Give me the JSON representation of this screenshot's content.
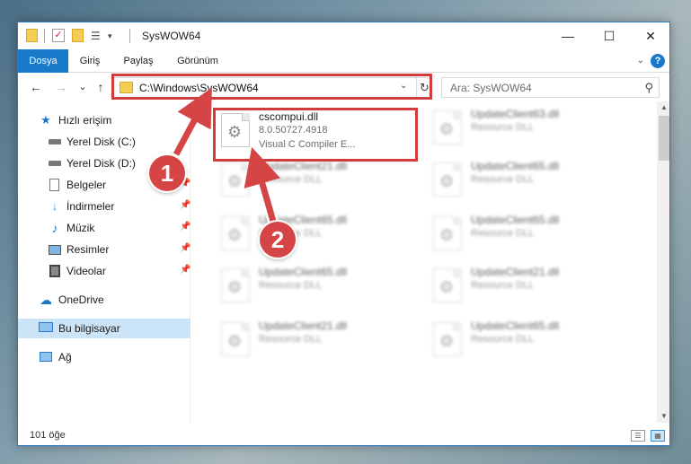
{
  "window": {
    "title": "SysWOW64"
  },
  "titlebar": {
    "minimize": "—",
    "maximize": "☐",
    "close": "✕"
  },
  "ribbon": {
    "tabs": [
      "Dosya",
      "Giriş",
      "Paylaş",
      "Görünüm"
    ],
    "active_tab": "Dosya",
    "help": "?"
  },
  "navigation": {
    "back": "←",
    "forward": "→",
    "recent": "⌄",
    "up": "↑",
    "address": "C:\\Windows\\SysWOW64",
    "refresh": "↻",
    "search_placeholder": "Ara: SysWOW64"
  },
  "sidebar": {
    "items": [
      {
        "label": "Hızlı erişim",
        "icon": "star-icon",
        "pinned": false
      },
      {
        "label": "Yerel Disk (C:)",
        "icon": "drive-icon",
        "pinned": false
      },
      {
        "label": "Yerel Disk (D:)",
        "icon": "drive-icon",
        "pinned": false
      },
      {
        "label": "Belgeler",
        "icon": "documents-icon",
        "pinned": true
      },
      {
        "label": "İndirmeler",
        "icon": "download-icon",
        "pinned": true
      },
      {
        "label": "Müzik",
        "icon": "music-icon",
        "pinned": true
      },
      {
        "label": "Resimler",
        "icon": "pictures-icon",
        "pinned": true
      },
      {
        "label": "Videolar",
        "icon": "video-icon",
        "pinned": true
      },
      {
        "label": "OneDrive",
        "icon": "cloud-icon",
        "pinned": false
      },
      {
        "label": "Bu bilgisayar",
        "icon": "computer-icon",
        "pinned": false,
        "selected": true
      },
      {
        "label": "Ağ",
        "icon": "network-icon",
        "pinned": false
      }
    ]
  },
  "files": [
    {
      "name": "cscompui.dll",
      "version": "8.0.50727.4918",
      "description": "Visual C Compiler E...",
      "highlighted": true
    },
    {
      "name": "UpdateClient63.dll",
      "type": "Resource DLL"
    },
    {
      "name": "UpdateClient21.dll",
      "type": "Resource DLL"
    },
    {
      "name": "UpdateClient65.dll",
      "type": "Resource DLL"
    },
    {
      "name": "UpdateClient65.dll",
      "type": "Resource DLL"
    },
    {
      "name": "UpdateClient65.dll",
      "type": "Resource DLL"
    },
    {
      "name": "UpdateClient65.dll",
      "type": "Resource DLL"
    },
    {
      "name": "UpdateClient21.dll",
      "type": "Resource DLL"
    },
    {
      "name": "UpdateClient21.dll",
      "type": "Resource DLL"
    },
    {
      "name": "UpdateClient65.dll",
      "type": "Resource DLL"
    }
  ],
  "status": {
    "item_count": "101 öğe"
  },
  "annotations": {
    "step1": "1",
    "step2": "2",
    "highlight_color": "#d23b3b"
  }
}
